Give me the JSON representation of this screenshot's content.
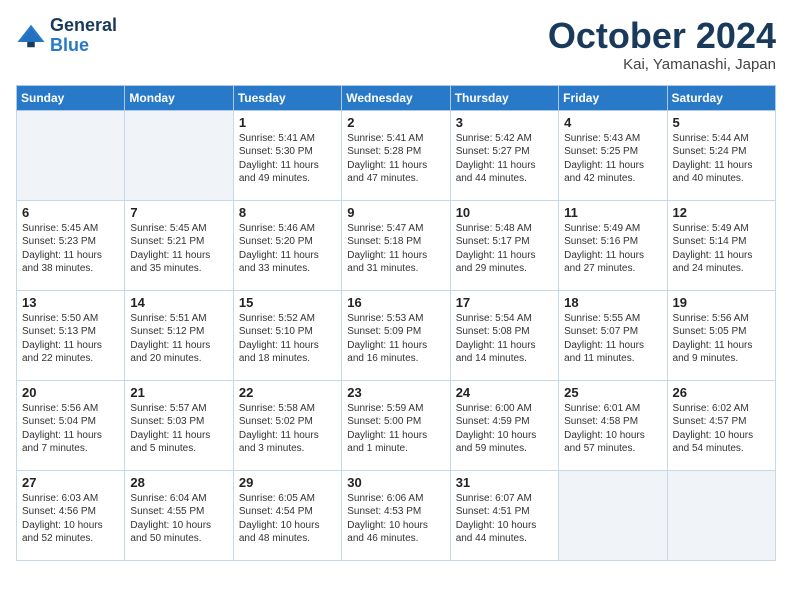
{
  "logo": {
    "line1": "General",
    "line2": "Blue"
  },
  "title": "October 2024",
  "location": "Kai, Yamanashi, Japan",
  "days_of_week": [
    "Sunday",
    "Monday",
    "Tuesday",
    "Wednesday",
    "Thursday",
    "Friday",
    "Saturday"
  ],
  "weeks": [
    [
      {
        "day": "",
        "info": ""
      },
      {
        "day": "",
        "info": ""
      },
      {
        "day": "1",
        "info": "Sunrise: 5:41 AM\nSunset: 5:30 PM\nDaylight: 11 hours and 49 minutes."
      },
      {
        "day": "2",
        "info": "Sunrise: 5:41 AM\nSunset: 5:28 PM\nDaylight: 11 hours and 47 minutes."
      },
      {
        "day": "3",
        "info": "Sunrise: 5:42 AM\nSunset: 5:27 PM\nDaylight: 11 hours and 44 minutes."
      },
      {
        "day": "4",
        "info": "Sunrise: 5:43 AM\nSunset: 5:25 PM\nDaylight: 11 hours and 42 minutes."
      },
      {
        "day": "5",
        "info": "Sunrise: 5:44 AM\nSunset: 5:24 PM\nDaylight: 11 hours and 40 minutes."
      }
    ],
    [
      {
        "day": "6",
        "info": "Sunrise: 5:45 AM\nSunset: 5:23 PM\nDaylight: 11 hours and 38 minutes."
      },
      {
        "day": "7",
        "info": "Sunrise: 5:45 AM\nSunset: 5:21 PM\nDaylight: 11 hours and 35 minutes."
      },
      {
        "day": "8",
        "info": "Sunrise: 5:46 AM\nSunset: 5:20 PM\nDaylight: 11 hours and 33 minutes."
      },
      {
        "day": "9",
        "info": "Sunrise: 5:47 AM\nSunset: 5:18 PM\nDaylight: 11 hours and 31 minutes."
      },
      {
        "day": "10",
        "info": "Sunrise: 5:48 AM\nSunset: 5:17 PM\nDaylight: 11 hours and 29 minutes."
      },
      {
        "day": "11",
        "info": "Sunrise: 5:49 AM\nSunset: 5:16 PM\nDaylight: 11 hours and 27 minutes."
      },
      {
        "day": "12",
        "info": "Sunrise: 5:49 AM\nSunset: 5:14 PM\nDaylight: 11 hours and 24 minutes."
      }
    ],
    [
      {
        "day": "13",
        "info": "Sunrise: 5:50 AM\nSunset: 5:13 PM\nDaylight: 11 hours and 22 minutes."
      },
      {
        "day": "14",
        "info": "Sunrise: 5:51 AM\nSunset: 5:12 PM\nDaylight: 11 hours and 20 minutes."
      },
      {
        "day": "15",
        "info": "Sunrise: 5:52 AM\nSunset: 5:10 PM\nDaylight: 11 hours and 18 minutes."
      },
      {
        "day": "16",
        "info": "Sunrise: 5:53 AM\nSunset: 5:09 PM\nDaylight: 11 hours and 16 minutes."
      },
      {
        "day": "17",
        "info": "Sunrise: 5:54 AM\nSunset: 5:08 PM\nDaylight: 11 hours and 14 minutes."
      },
      {
        "day": "18",
        "info": "Sunrise: 5:55 AM\nSunset: 5:07 PM\nDaylight: 11 hours and 11 minutes."
      },
      {
        "day": "19",
        "info": "Sunrise: 5:56 AM\nSunset: 5:05 PM\nDaylight: 11 hours and 9 minutes."
      }
    ],
    [
      {
        "day": "20",
        "info": "Sunrise: 5:56 AM\nSunset: 5:04 PM\nDaylight: 11 hours and 7 minutes."
      },
      {
        "day": "21",
        "info": "Sunrise: 5:57 AM\nSunset: 5:03 PM\nDaylight: 11 hours and 5 minutes."
      },
      {
        "day": "22",
        "info": "Sunrise: 5:58 AM\nSunset: 5:02 PM\nDaylight: 11 hours and 3 minutes."
      },
      {
        "day": "23",
        "info": "Sunrise: 5:59 AM\nSunset: 5:00 PM\nDaylight: 11 hours and 1 minute."
      },
      {
        "day": "24",
        "info": "Sunrise: 6:00 AM\nSunset: 4:59 PM\nDaylight: 10 hours and 59 minutes."
      },
      {
        "day": "25",
        "info": "Sunrise: 6:01 AM\nSunset: 4:58 PM\nDaylight: 10 hours and 57 minutes."
      },
      {
        "day": "26",
        "info": "Sunrise: 6:02 AM\nSunset: 4:57 PM\nDaylight: 10 hours and 54 minutes."
      }
    ],
    [
      {
        "day": "27",
        "info": "Sunrise: 6:03 AM\nSunset: 4:56 PM\nDaylight: 10 hours and 52 minutes."
      },
      {
        "day": "28",
        "info": "Sunrise: 6:04 AM\nSunset: 4:55 PM\nDaylight: 10 hours and 50 minutes."
      },
      {
        "day": "29",
        "info": "Sunrise: 6:05 AM\nSunset: 4:54 PM\nDaylight: 10 hours and 48 minutes."
      },
      {
        "day": "30",
        "info": "Sunrise: 6:06 AM\nSunset: 4:53 PM\nDaylight: 10 hours and 46 minutes."
      },
      {
        "day": "31",
        "info": "Sunrise: 6:07 AM\nSunset: 4:51 PM\nDaylight: 10 hours and 44 minutes."
      },
      {
        "day": "",
        "info": ""
      },
      {
        "day": "",
        "info": ""
      }
    ]
  ]
}
